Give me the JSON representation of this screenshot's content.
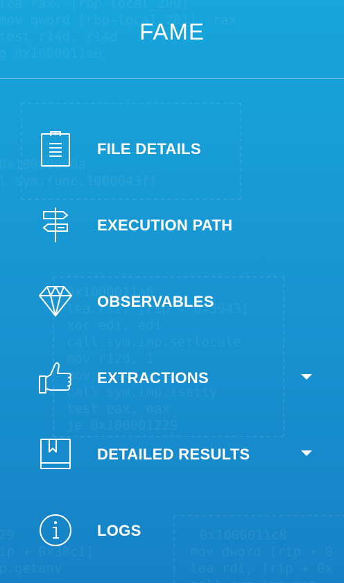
{
  "app": {
    "title": "FAME"
  },
  "colors": {
    "background_top": "#17a5db",
    "background_bottom": "#1682c6",
    "foreground": "#ffffff"
  },
  "nav": {
    "items": [
      {
        "label": "FILE DETAILS",
        "icon": "clipboard-icon",
        "has_dropdown": false
      },
      {
        "label": "EXECUTION PATH",
        "icon": "signpost-icon",
        "has_dropdown": false
      },
      {
        "label": "OBSERVABLES",
        "icon": "diamond-icon",
        "has_dropdown": false
      },
      {
        "label": "EXTRACTIONS",
        "icon": "thumbs-up-icon",
        "has_dropdown": true
      },
      {
        "label": "DETAILED RESULTS",
        "icon": "book-icon",
        "has_dropdown": true
      },
      {
        "label": "LOGS",
        "icon": "info-icon",
        "has_dropdown": false
      }
    ]
  },
  "background_code": [
    "lea rax, [rbp-local_200]",
    "mov qword [rbp-local_201], rax",
    "test r14d, r14d",
    "g 0x1000011a6",
    "0x10000000a",
    "l sym.func.1000043ff",
    "0x1000011a6",
    "lea rsi, [rip + 0x3943]",
    "xor edi, edi",
    "call sym.imp.setlocale",
    "mov r12d, 1",
    "mov ...",
    "call sym.imp.isatty",
    "test eax, eax",
    "je 0x100001229",
    "29",
    "ip + 0x38c1]",
    "p.getenv",
    "0x1000011c8",
    "mov dword [rip + 0",
    "lea rdi, [rip + 0x",
    "call sym.imp.get"
  ]
}
